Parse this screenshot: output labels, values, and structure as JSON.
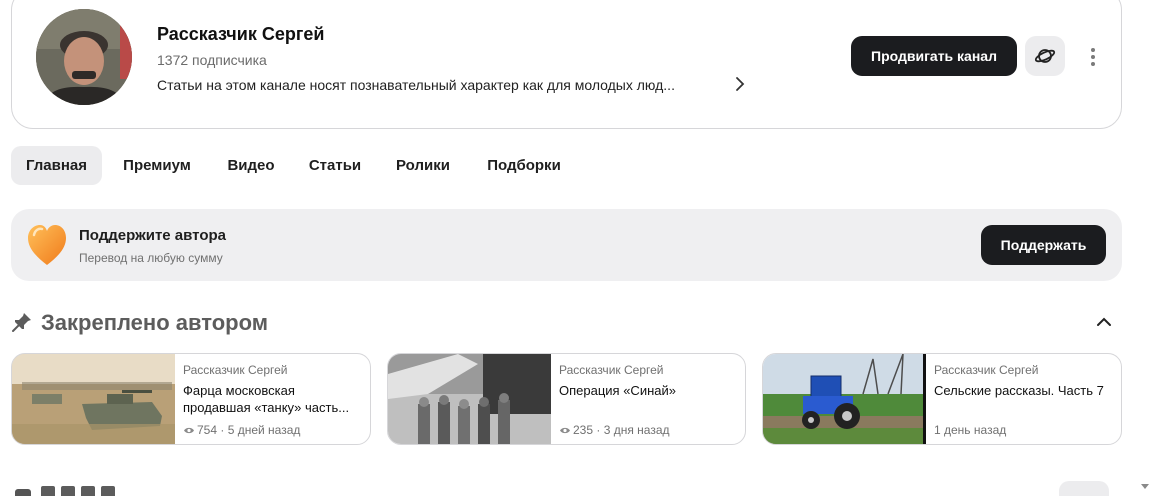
{
  "channel": {
    "name": "Рассказчик Сергей",
    "subscribers": "1372 подписчика",
    "description": "Статьи на этом канале носят познавательный характер как для молодых люд...",
    "promote_label": "Продвигать канал",
    "icons": {
      "avatar": "author-photo",
      "planet": "planet-icon",
      "more": "more-vertical-icon",
      "expand": "chevron-right-icon"
    }
  },
  "tabs": [
    {
      "label": "Главная",
      "active": true
    },
    {
      "label": "Премиум",
      "active": false
    },
    {
      "label": "Видео",
      "active": false
    },
    {
      "label": "Статьи",
      "active": false
    },
    {
      "label": "Ролики",
      "active": false
    },
    {
      "label": "Подборки",
      "active": false
    }
  ],
  "support": {
    "title": "Поддержите автора",
    "subtitle": "Перевод на любую сумму",
    "button_label": "Поддержать",
    "icon": "heart-icon",
    "accent": "#f39a2d"
  },
  "pinned": {
    "title": "Закреплено автором",
    "icon": "pin-icon",
    "collapse_icon": "chevron-up-icon",
    "posts": [
      {
        "author": "Рассказчик Сергей",
        "title": "Фарца московская продавшая «танку» часть...",
        "views": "754",
        "date": "5 дней назад",
        "thumb": "military-vehicles-in-field"
      },
      {
        "author": "Рассказчик Сергей",
        "title": "Операция «Синай»",
        "views": "235",
        "date": "3 дня назад",
        "thumb": "soldiers-by-artillery-bw"
      },
      {
        "author": "Рассказчик Сергей",
        "title": "Сельские рассказы. Часть 7",
        "views": "",
        "date": "1 день назад",
        "thumb": "blue-tractor-on-road"
      }
    ]
  },
  "colors": {
    "primary_button": "#1b1c1f",
    "tab_active_bg": "#ececee",
    "banner_bg": "#efeff1",
    "border": "#d6d6d9"
  }
}
